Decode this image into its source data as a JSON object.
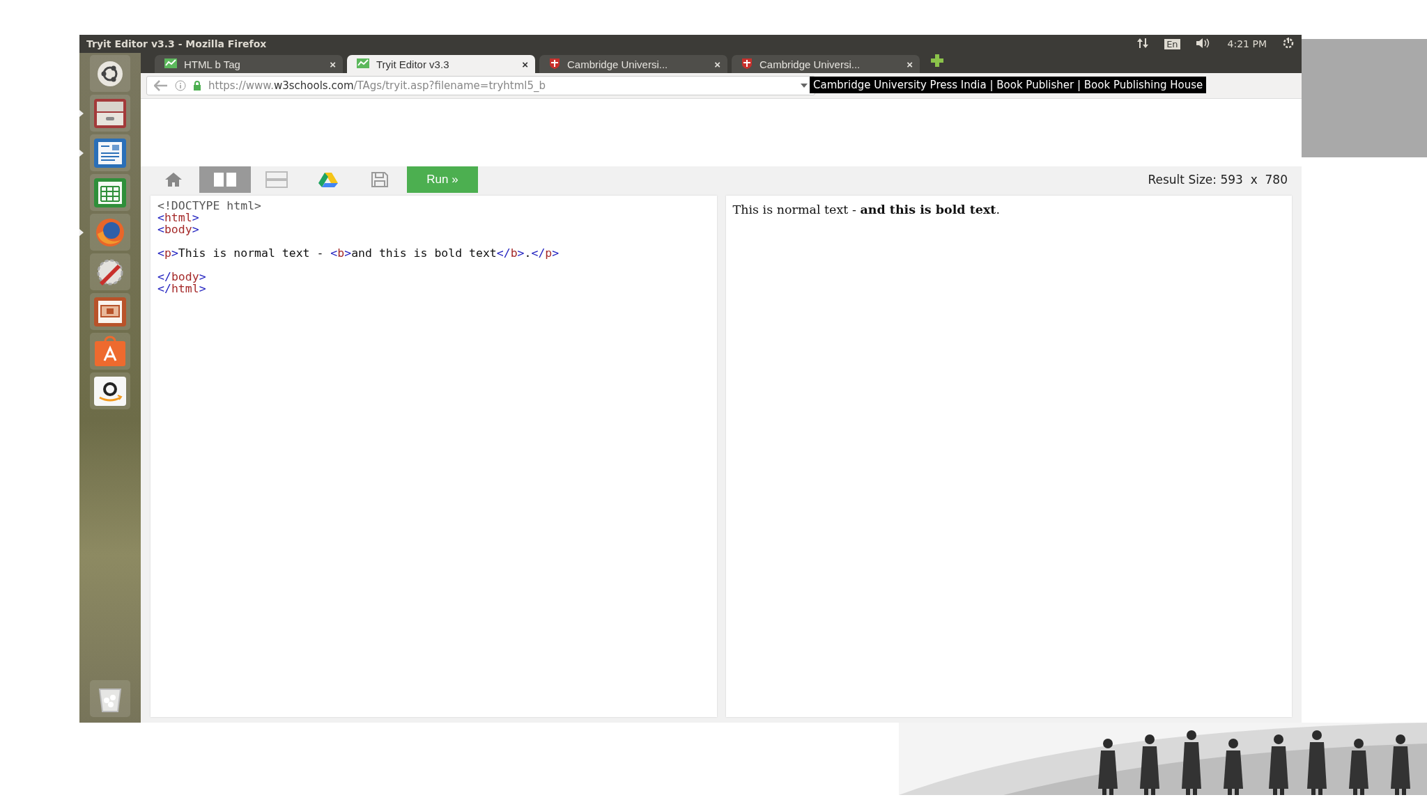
{
  "window": {
    "title": "Tryit Editor v3.3 - Mozilla Firefox"
  },
  "indicators": {
    "keyboard": "En",
    "clock": "4:21 PM"
  },
  "launcher": [
    {
      "kind": "ubuntu",
      "running": false
    },
    {
      "kind": "files",
      "running": true
    },
    {
      "kind": "writer",
      "running": true
    },
    {
      "kind": "calc",
      "running": false
    },
    {
      "kind": "firefox",
      "running": true
    },
    {
      "kind": "settings",
      "running": false
    },
    {
      "kind": "impress",
      "running": false
    },
    {
      "kind": "software",
      "running": false
    },
    {
      "kind": "amazon",
      "running": false
    },
    {
      "kind": "trash",
      "running": false
    }
  ],
  "tabs": [
    {
      "label": "HTML b Tag",
      "kind": "w3",
      "selected": false,
      "close": "×"
    },
    {
      "label": "Tryit Editor v3.3",
      "kind": "w3",
      "selected": true,
      "close": "×"
    },
    {
      "label": "Cambridge Universi...",
      "kind": "cambridge",
      "selected": false,
      "close": "×"
    },
    {
      "label": "Cambridge Universi...",
      "kind": "cambridge",
      "selected": false,
      "close": "×"
    }
  ],
  "address_bar": {
    "url_start": "https://www.",
    "url_domain": "w3schools.com",
    "url_end": "/TAgs/tryit.asp?filename=tryhtml5_b"
  },
  "tooltip": "Cambridge University Press India | Book Publisher | Book Publishing House",
  "toolbar": {
    "buttons": [
      {
        "kind": "home",
        "selected": false
      },
      {
        "kind": "columns",
        "selected": true
      },
      {
        "kind": "rows",
        "selected": false
      },
      {
        "kind": "drive",
        "selected": false
      },
      {
        "kind": "save",
        "selected": false
      }
    ],
    "run": "Run »",
    "result_size": "Result Size: 593  x  780"
  },
  "code_lines": [
    {
      "gap_before": false,
      "tokens": [
        {
          "kind": "doctype",
          "text": "<!DOCTYPE html>"
        }
      ]
    },
    {
      "gap_before": false,
      "tokens": [
        {
          "kind": "punct",
          "text": "<"
        },
        {
          "kind": "tag",
          "text": "html"
        },
        {
          "kind": "punct",
          "text": ">"
        }
      ]
    },
    {
      "gap_before": false,
      "tokens": [
        {
          "kind": "punct",
          "text": "<"
        },
        {
          "kind": "tag",
          "text": "body"
        },
        {
          "kind": "punct",
          "text": ">"
        }
      ]
    },
    {
      "gap_before": true,
      "tokens": [
        {
          "kind": "punct",
          "text": "<"
        },
        {
          "kind": "tag",
          "text": "p"
        },
        {
          "kind": "punct",
          "text": ">"
        },
        {
          "kind": "text",
          "text": "This is normal text - "
        },
        {
          "kind": "punct",
          "text": "<"
        },
        {
          "kind": "tag",
          "text": "b"
        },
        {
          "kind": "punct",
          "text": ">"
        },
        {
          "kind": "text",
          "text": "and this is bold text"
        },
        {
          "kind": "punct",
          "text": "</"
        },
        {
          "kind": "tag",
          "text": "b"
        },
        {
          "kind": "punct",
          "text": ">"
        },
        {
          "kind": "text",
          "text": "."
        },
        {
          "kind": "punct",
          "text": "</"
        },
        {
          "kind": "tag",
          "text": "p"
        },
        {
          "kind": "punct",
          "text": ">"
        }
      ]
    },
    {
      "gap_before": true,
      "tokens": [
        {
          "kind": "punct",
          "text": "</"
        },
        {
          "kind": "tag",
          "text": "body"
        },
        {
          "kind": "punct",
          "text": ">"
        }
      ]
    },
    {
      "gap_before": false,
      "tokens": [
        {
          "kind": "punct",
          "text": "</"
        },
        {
          "kind": "tag",
          "text": "html"
        },
        {
          "kind": "punct",
          "text": ">"
        }
      ]
    }
  ],
  "result_text": "This is normal text - **and this is bold text**."
}
